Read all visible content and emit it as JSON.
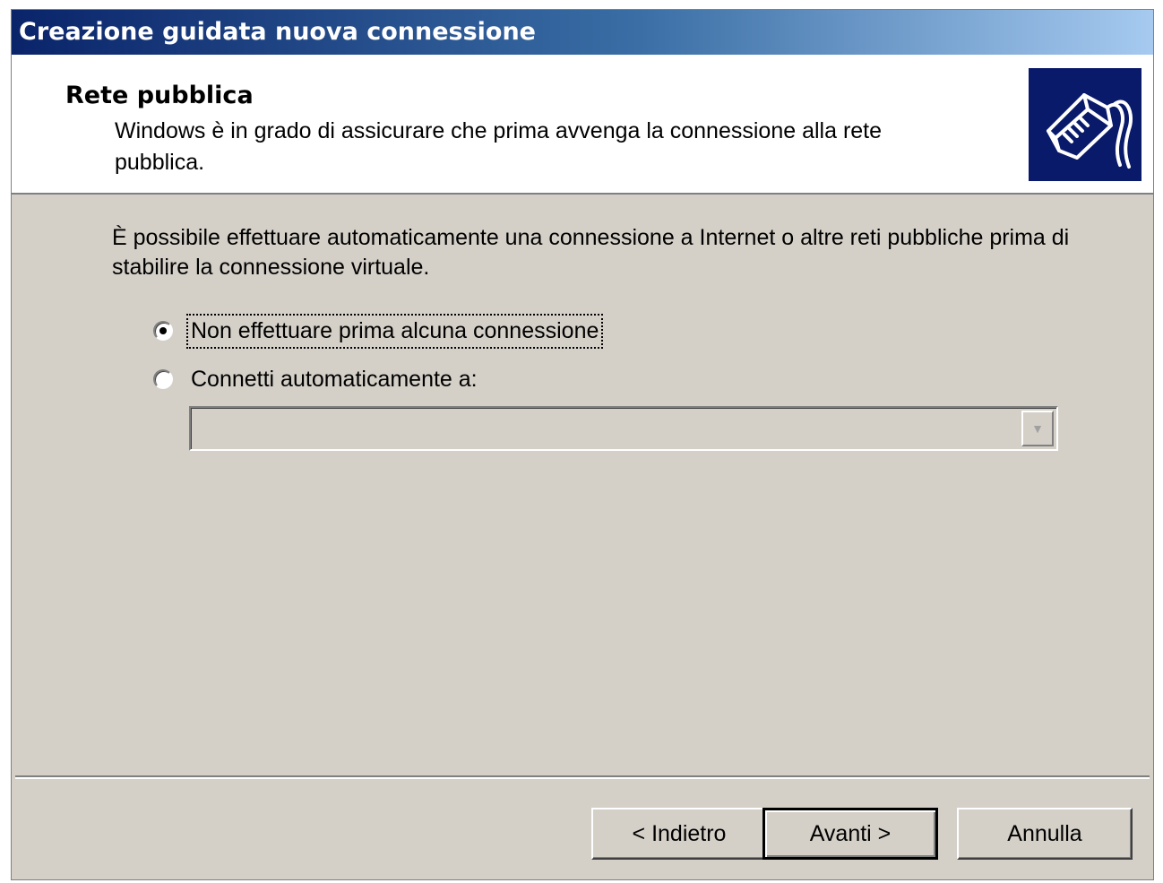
{
  "window": {
    "title": "Creazione guidata nuova connessione"
  },
  "header": {
    "title": "Rete pubblica",
    "subtitle": "Windows è in grado di assicurare che prima avvenga la connessione alla rete pubblica.",
    "image_icon": "network-plug-icon"
  },
  "content": {
    "intro": "È possibile effettuare automaticamente una connessione a Internet o altre reti pubbliche prima di stabilire la connessione virtuale.",
    "options": [
      {
        "label": "Non effettuare prima alcuna connessione",
        "checked": true
      },
      {
        "label": "Connetti automaticamente a:",
        "checked": false
      }
    ],
    "combo": {
      "value": "",
      "enabled": false
    }
  },
  "buttons": {
    "back": "< Indietro",
    "next": "Avanti >",
    "cancel": "Annulla"
  },
  "colors": {
    "face": "#d4d0c8",
    "title_start": "#0a246a",
    "title_end": "#a6caf0",
    "header_image_bg": "#0a1a6a"
  }
}
